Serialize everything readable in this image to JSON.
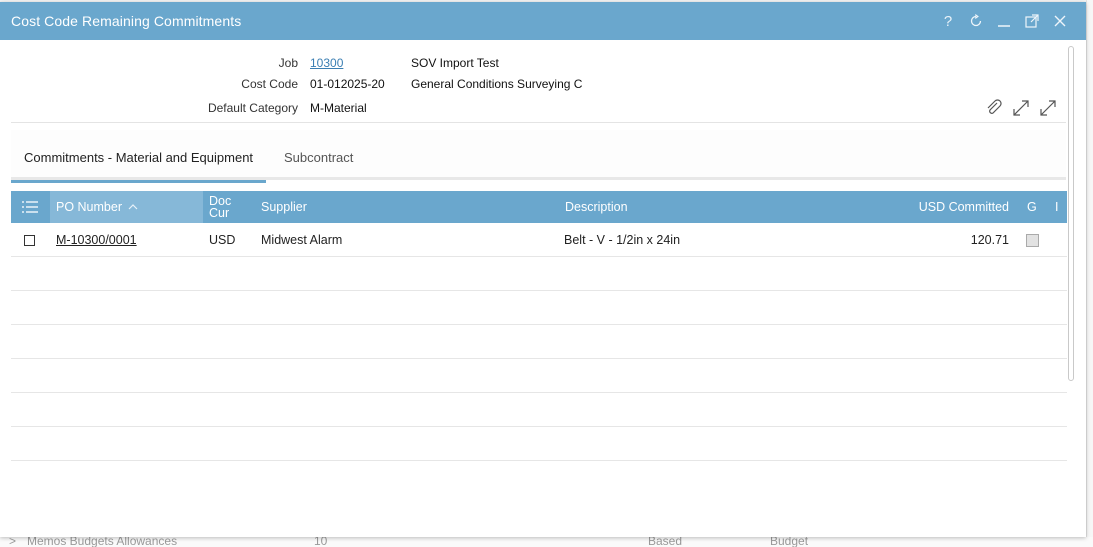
{
  "window": {
    "title": "Cost Code Remaining Commitments",
    "controls": {
      "help": "?"
    }
  },
  "header": {
    "job_label": "Job",
    "job_value": "10300",
    "job_desc": "SOV Import Test",
    "cost_code_label": "Cost Code",
    "cost_code_value": "01-012025-20",
    "cost_code_desc": "General Conditions Surveying C",
    "default_category_label": "Default Category",
    "default_category_value": "M-Material"
  },
  "tabs": [
    {
      "label": "Commitments - Material and Equipment",
      "active": true
    },
    {
      "label": "Subcontract",
      "active": false
    }
  ],
  "grid": {
    "columns": {
      "po_number": "PO Number",
      "doc_cur_line1": "Doc",
      "doc_cur_line2": "Cur",
      "supplier": "Supplier",
      "description": "Description",
      "usd_committed": "USD Committed",
      "g": "G",
      "i": "I"
    },
    "sort": {
      "column": "PO Number",
      "direction": "ascending"
    },
    "rows": [
      {
        "po_number": "M-10300/0001",
        "doc_cur": "USD",
        "supplier": "Midwest Alarm",
        "description": "Belt - V - 1/2in x 24in",
        "usd_committed": "120.71"
      }
    ],
    "empty_rows": 7
  },
  "background": {
    "bottom_text_1": "Memos Budgets Allowances",
    "bottom_text_2": "10",
    "bottom_text_3": "Based",
    "bottom_text_4": "Budget"
  },
  "colors": {
    "titlebar": "#6aa7cd",
    "grid_header": "#6aa7cd",
    "link": "#3b7fb3"
  }
}
